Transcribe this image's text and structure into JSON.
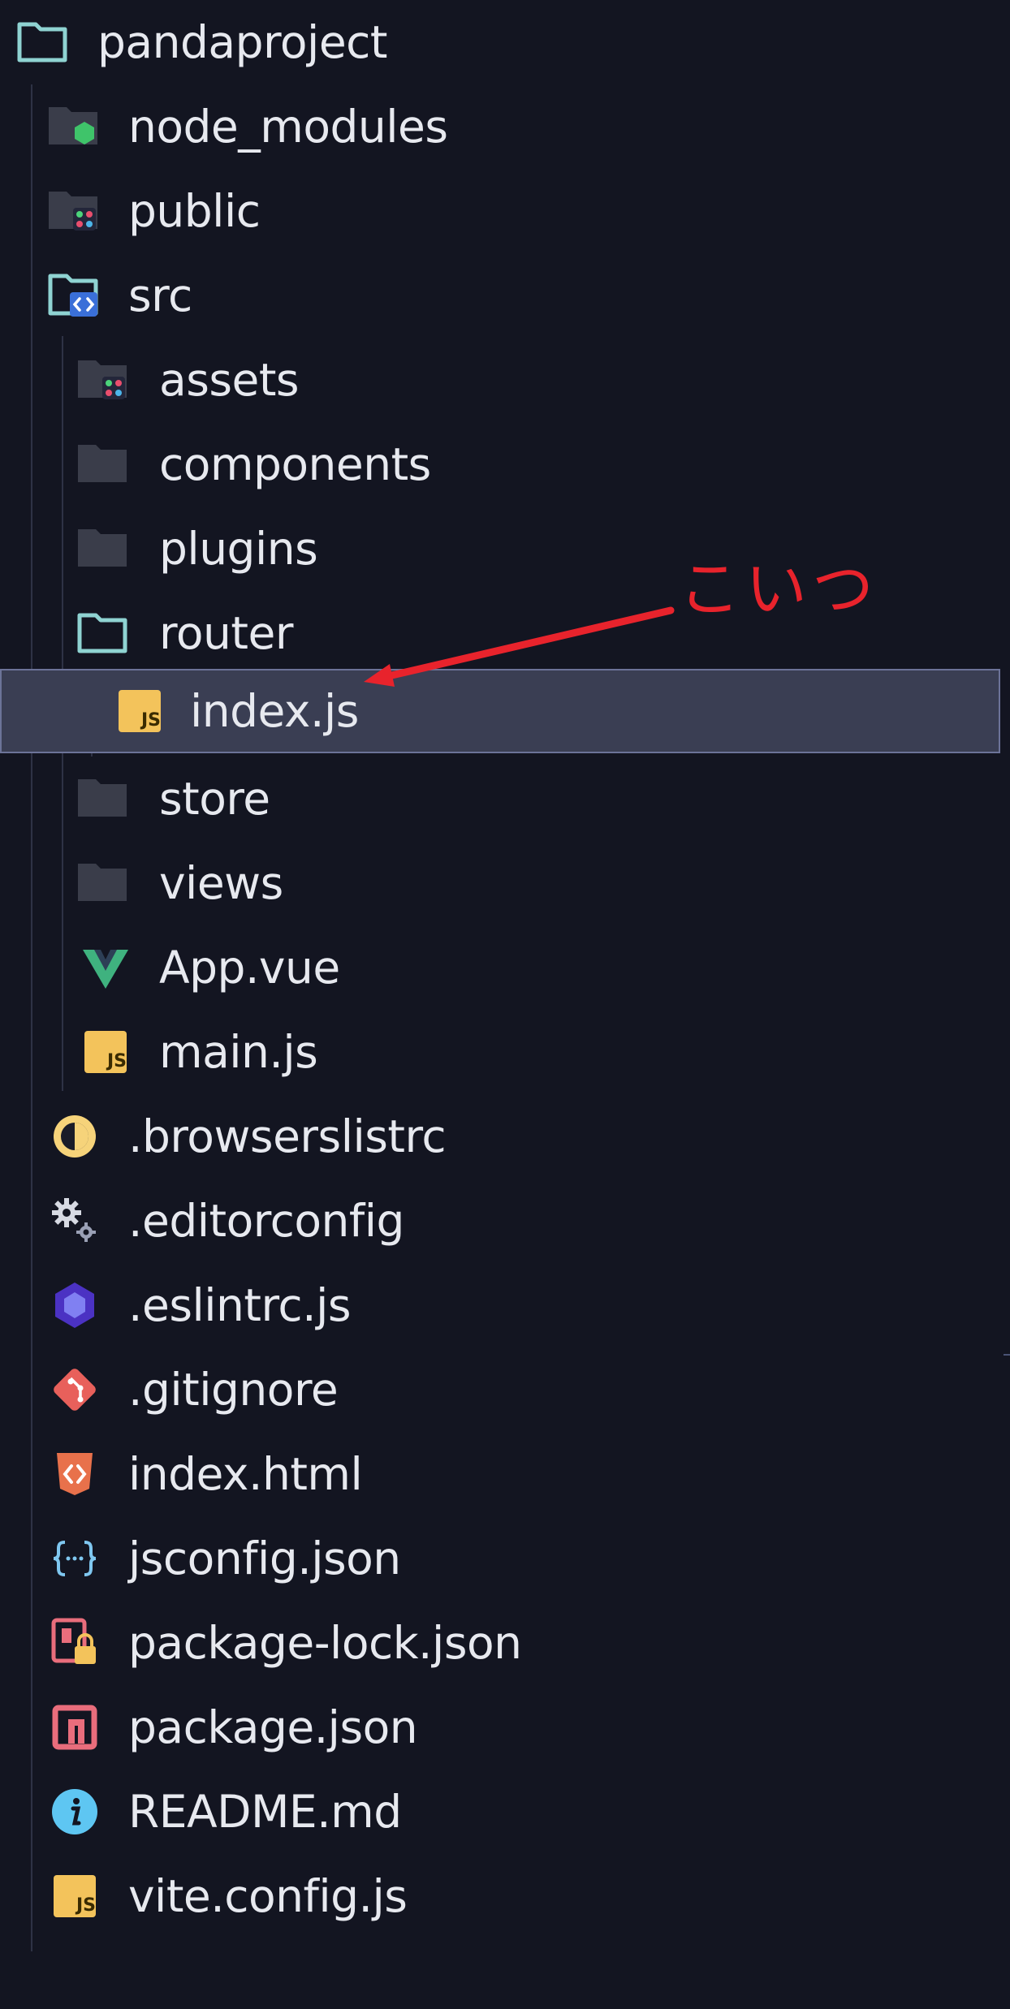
{
  "explorer": {
    "root": {
      "label": "pandaproject",
      "icon": "folder-open-icon"
    },
    "items": [
      {
        "label": "node_modules",
        "icon": "node-folder-icon",
        "depth": 1
      },
      {
        "label": "public",
        "icon": "public-folder-icon",
        "depth": 1
      },
      {
        "label": "src",
        "icon": "src-folder-open-icon",
        "depth": 1
      },
      {
        "label": "assets",
        "icon": "assets-folder-icon",
        "depth": 2
      },
      {
        "label": "components",
        "icon": "folder-icon",
        "depth": 2
      },
      {
        "label": "plugins",
        "icon": "folder-icon",
        "depth": 2
      },
      {
        "label": "router",
        "icon": "folder-open-icon",
        "depth": 2
      },
      {
        "label": "index.js",
        "icon": "javascript-file-icon",
        "depth": 3,
        "selected": true
      },
      {
        "label": "store",
        "icon": "folder-icon",
        "depth": 2
      },
      {
        "label": "views",
        "icon": "folder-icon",
        "depth": 2
      },
      {
        "label": "App.vue",
        "icon": "vue-file-icon",
        "depth": 2
      },
      {
        "label": "main.js",
        "icon": "javascript-file-icon",
        "depth": 2
      },
      {
        "label": ".browserslistrc",
        "icon": "browserslist-icon",
        "depth": 1
      },
      {
        "label": ".editorconfig",
        "icon": "editorconfig-gear-icon",
        "depth": 1
      },
      {
        "label": ".eslintrc.js",
        "icon": "eslint-icon",
        "depth": 1
      },
      {
        "label": ".gitignore",
        "icon": "git-icon",
        "depth": 1
      },
      {
        "label": "index.html",
        "icon": "html-file-icon",
        "depth": 1
      },
      {
        "label": "jsconfig.json",
        "icon": "json-braces-icon",
        "depth": 1
      },
      {
        "label": "package-lock.json",
        "icon": "lock-file-icon",
        "depth": 1
      },
      {
        "label": "package.json",
        "icon": "npm-icon",
        "depth": 1
      },
      {
        "label": "README.md",
        "icon": "info-icon",
        "depth": 1
      },
      {
        "label": "vite.config.js",
        "icon": "javascript-file-icon",
        "depth": 1
      }
    ]
  },
  "annotation": {
    "text": "こいつ",
    "color": "#e8232c"
  },
  "colors": {
    "background": "#131521",
    "text": "#e7e9ef",
    "selection": "#3a3e53",
    "selection_border": "#6c7398",
    "folder_open_accent": "#8fd3d2",
    "js_yellow": "#f3c35b",
    "vue_green": "#3fb27f"
  }
}
